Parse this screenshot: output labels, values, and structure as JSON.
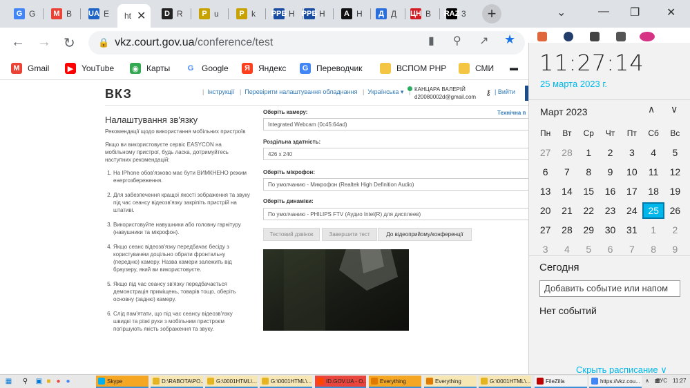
{
  "browser": {
    "tabs": [
      {
        "fav": "G",
        "label": "G",
        "color": "#4285f4"
      },
      {
        "fav": "M",
        "label": "B",
        "color": "#ea4335"
      },
      {
        "fav": "UA",
        "label": "E",
        "color": "#1e63c6"
      },
      {
        "fav": "",
        "label": "ht",
        "active": true
      },
      {
        "fav": "D",
        "label": "R",
        "color": "#222222"
      },
      {
        "fav": "Р",
        "label": "u",
        "color": "#c8a200"
      },
      {
        "fav": "Р",
        "label": "k",
        "color": "#c8a200"
      },
      {
        "fav": "РРБ",
        "label": "Н",
        "color": "#1a4da1"
      },
      {
        "fav": "РРБ",
        "label": "Н",
        "color": "#1a4da1"
      },
      {
        "fav": "A",
        "label": "Н",
        "color": "#111111"
      },
      {
        "fav": "Д",
        "label": "Д",
        "color": "#2a6fdb"
      },
      {
        "fav": "ЦН",
        "label": "В",
        "color": "#d21f26"
      },
      {
        "fav": "RAZ",
        "label": "3",
        "color": "#000000"
      }
    ],
    "url_host": "vkz.court.gov.ua",
    "url_path": "/conference/test",
    "bookmarks": [
      {
        "label": "Gmail",
        "icon": "gmail-icon"
      },
      {
        "label": "YouTube",
        "icon": "youtube-icon"
      },
      {
        "label": "Карты",
        "icon": "maps-icon"
      },
      {
        "label": "Google",
        "icon": "google-icon"
      },
      {
        "label": "Яндекс",
        "icon": "yandex-icon"
      },
      {
        "label": "Переводчик",
        "icon": "translate-icon"
      },
      {
        "label": "ВСПОМ PHP",
        "icon": "folder-icon"
      },
      {
        "label": "СМИ",
        "icon": "folder-icon"
      }
    ]
  },
  "site": {
    "logo": "ВКЗ",
    "nav": [
      "Інструкції",
      "Перевірити налаштування обладнання",
      "Українська"
    ],
    "user_name": "КАНЦАРА ВАЛЕРІЙ",
    "user_email": "d20080002d@gmail.com",
    "logout": "Вийти",
    "tech_support": "Технічна п",
    "heading": "Налаштування зв'язку",
    "intro1": "Рекомендації щодо використання мобільних пристроїв",
    "intro2": "Якщо ви використовуєте сервіс EASYCON на мобільному пристрої, будь ласка, дотримуйтесь наступних рекомендацій:",
    "tips": [
      "На IPhone обов'язково має бути ВИМКНЕНО режим енергозбереження.",
      "Для забезпечення кращої якості зображення та звуку під час сеансу відеозв'язку закріпіть пристрій на штативі.",
      "Використовуйте навушники або головну гарнітуру (навушники та мікрофон).",
      "Якщо сеанс відеозв'язку передбачає бесіду з користувачем доцільно обрати фронтальну (передню) камеру. Назва камери залежить від браузеру, який ви використовуєте.",
      "Якщо під час сеансу зв'язку передбачається демонстрація приміщень, товарів тощо, оберіть основну (задню) камеру.",
      "Слід пам'ятати, що під час сеансу відеозв'язку швидкі та різкі рухи з мобільним пристроєм погіршують якість зображення та звуку."
    ],
    "camera_label": "Оберіть камеру:",
    "camera_value": "Integrated Webcam (0c45:64ad)",
    "resolution_label": "Роздільна здатність:",
    "resolution_value": "426 x 240",
    "mic_label": "Оберіть мікрофон:",
    "mic_value": "По умолчанию - Микрофон (Realtek High Definition Audio)",
    "speaker_label": "Оберіть динаміки:",
    "speaker_value": "По умолчанию - PHILIPS FTV (Аудио Intel(R) для дисплеев)",
    "btn_test_call": "Тестовий дзвінок",
    "btn_end_test": "Завершити тест",
    "btn_join": "До відеоприйому/конференції"
  },
  "flyout": {
    "time": "11:27:14",
    "date": "25 марта 2023 г.",
    "month": "Март 2023",
    "weekdays": [
      "Пн",
      "Вт",
      "Ср",
      "Чт",
      "Пт",
      "Сб",
      "Вс"
    ],
    "weeks": [
      [
        "27",
        "28",
        "1",
        "2",
        "3",
        "4",
        "5"
      ],
      [
        "6",
        "7",
        "8",
        "9",
        "10",
        "11",
        "12"
      ],
      [
        "13",
        "14",
        "15",
        "16",
        "17",
        "18",
        "19"
      ],
      [
        "20",
        "21",
        "22",
        "23",
        "24",
        "25",
        "26"
      ],
      [
        "27",
        "28",
        "29",
        "30",
        "31",
        "1",
        "2"
      ],
      [
        "3",
        "4",
        "5",
        "6",
        "7",
        "8",
        "9"
      ]
    ],
    "today_label": "Сегодня",
    "add_event": "Добавить событие или напом",
    "no_events": "Нет событий",
    "hide_schedule": "Скрыть расписание"
  },
  "taskbar": {
    "tasks": [
      {
        "label": "Skype",
        "color": "#f5a623",
        "icon_color": "#00aff0"
      },
      {
        "label": "D:\\RABOTA\\PO...",
        "color": "#f6e7b4",
        "icon_color": "#e6b422"
      },
      {
        "label": "G:\\0001HTML\\...",
        "color": "#f6e7b4",
        "icon_color": "#e6b422"
      },
      {
        "label": "G:\\0001HTML\\...",
        "color": "#f6e7b4",
        "icon_color": "#e6b422"
      },
      {
        "label": "ID.GOV.UA - O...",
        "color": "#e8453c",
        "icon_color": "#ff4500"
      },
      {
        "label": "Everything",
        "color": "#f5a623",
        "icon_color": "#e07b00"
      },
      {
        "label": "Everything",
        "color": "#f6e7b4",
        "icon_color": "#e07b00"
      },
      {
        "label": "G:\\0001HTML\\...",
        "color": "#f6e7b4",
        "icon_color": "#e6b422"
      },
      {
        "label": "FileZilla",
        "color": "#f3f3f3",
        "icon_color": "#bf0000"
      },
      {
        "label": "https://vkz.cou...",
        "color": "#f3f3f3",
        "icon_color": "#4285f4"
      }
    ],
    "lang": "РУС",
    "clock": "11:27"
  }
}
